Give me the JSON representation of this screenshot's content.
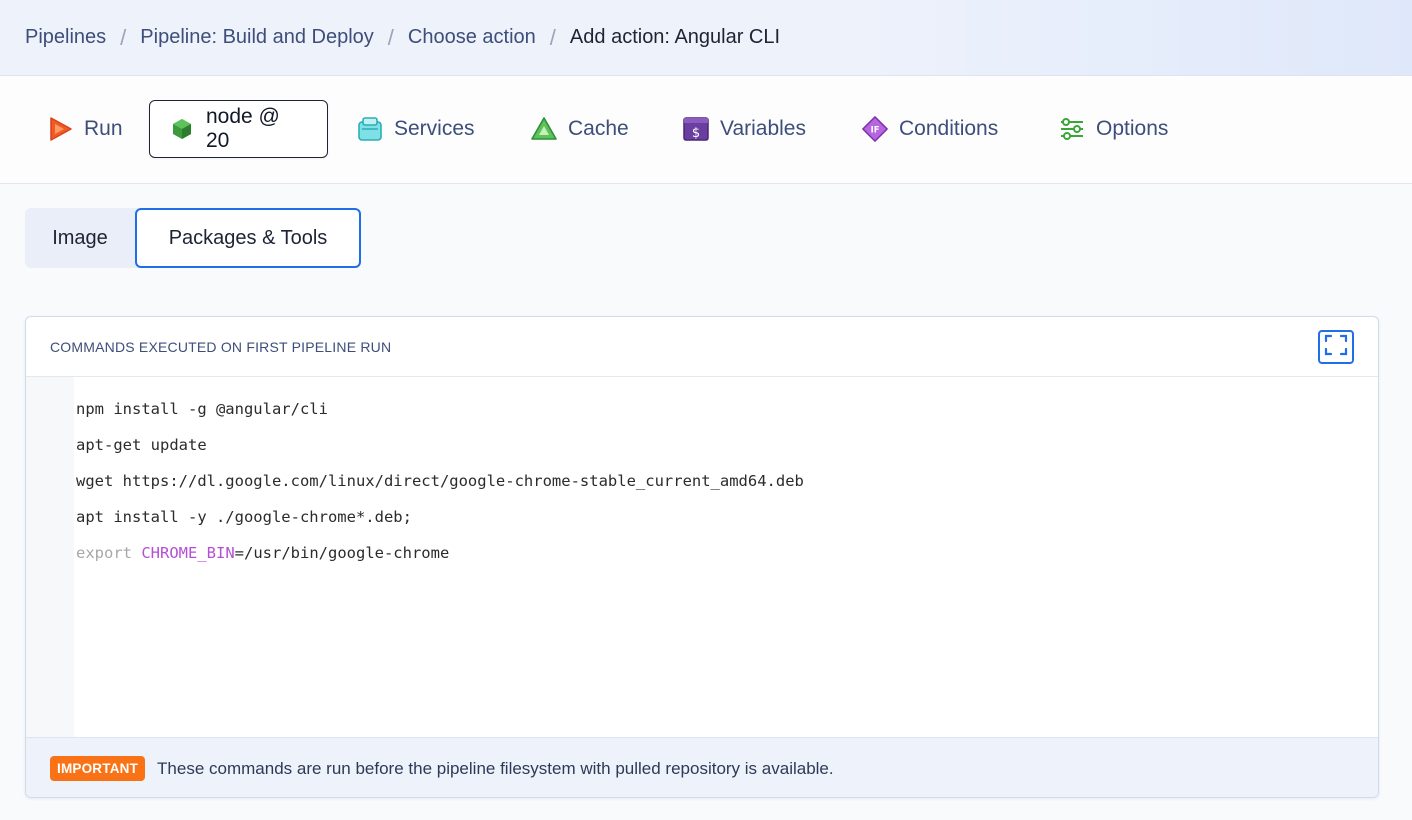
{
  "breadcrumb": {
    "items": [
      "Pipelines",
      "Pipeline: Build and Deploy",
      "Choose action"
    ],
    "current": "Add action: Angular CLI",
    "separator": "/"
  },
  "top_tabs": [
    {
      "label": "Run",
      "icon": "play-icon",
      "color": "#f05a28"
    },
    {
      "label": "node @ 20",
      "icon": "node-hex-icon",
      "color": "#3c9a3c",
      "active": true
    },
    {
      "label": "Services",
      "icon": "services-box-icon",
      "color": "#2dc0c8"
    },
    {
      "label": "Cache",
      "icon": "cache-triangle-icon",
      "color": "#45b649"
    },
    {
      "label": "Variables",
      "icon": "dollar-icon",
      "color": "#6b3fa0"
    },
    {
      "label": "Conditions",
      "icon": "if-diamond-icon",
      "color": "#9b4dca"
    },
    {
      "label": "Options",
      "icon": "sliders-icon",
      "color": "#3aa63a"
    }
  ],
  "sub_tabs": {
    "image": "Image",
    "packages": "Packages & Tools",
    "active": "Packages & Tools"
  },
  "commands_panel": {
    "title": "COMMANDS EXECUTED ON FIRST PIPELINE RUN",
    "expand_icon": "fullscreen-icon",
    "lines": [
      "npm install -g @angular/cli",
      "apt-get update",
      "wget https://dl.google.com/linux/direct/google-chrome-stable_current_amd64.deb",
      "apt install -y ./google-chrome*.deb;"
    ],
    "export_line": {
      "keyword": "export",
      "variable": "CHROME_BIN",
      "value": "=/usr/bin/google-chrome"
    },
    "footer": {
      "badge": "IMPORTANT",
      "note": "These commands are run before the pipeline filesystem with pulled repository is available."
    }
  },
  "colors": {
    "accent": "#1f6fe6",
    "important": "#f97316"
  }
}
